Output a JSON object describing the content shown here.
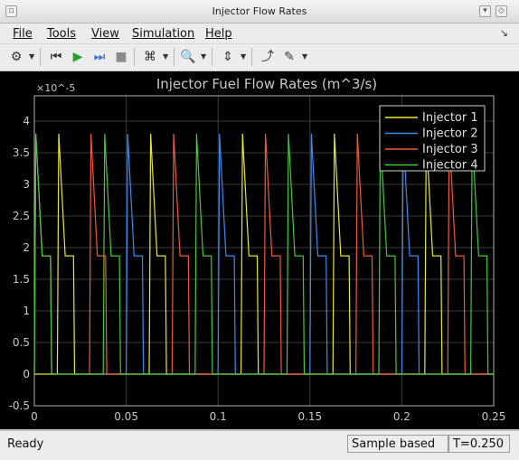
{
  "window": {
    "title": "Injector Flow Rates"
  },
  "menu": [
    "File",
    "Tools",
    "View",
    "Simulation",
    "Help"
  ],
  "toolbar": {
    "icons": [
      "gear-icon",
      "rewind-icon",
      "run-icon",
      "step-forward-icon",
      "stop-icon",
      "signal-select-icon",
      "zoom-icon",
      "fit-axes-icon",
      "highlight-block-icon",
      "style-icon"
    ]
  },
  "status": {
    "state": "Ready",
    "mode": "Sample based",
    "time": "T=0.250"
  },
  "colors": {
    "background": "#000000",
    "axes": "#b4b4b4",
    "grid": "#3a3a3a"
  },
  "chart_data": {
    "type": "line",
    "title": "Injector Fuel Flow Rates (m^3/s)",
    "y_exponent_label": "×10^-5",
    "xlim": [
      0,
      0.25
    ],
    "ylim": [
      -0.5,
      4.4
    ],
    "x_ticks": [
      0,
      0.05,
      0.1,
      0.15,
      0.2,
      0.25
    ],
    "x_tick_labels": [
      "0",
      "0.05",
      "0.1",
      "0.15",
      "0.2",
      "0.25"
    ],
    "y_ticks": [
      -0.5,
      0,
      0.5,
      1,
      1.5,
      2,
      2.5,
      3,
      3.5,
      4
    ],
    "y_tick_labels": [
      "-0.5",
      "0",
      "0.5",
      "1",
      "1.5",
      "2",
      "2.5",
      "3",
      "3.5",
      "4"
    ],
    "grid": true,
    "legend_position": "top-right",
    "pulse_shape": {
      "peak": 3.8,
      "plateau": 1.87,
      "rise_s": 0.0008,
      "decay_s": 0.0035,
      "plateau_s": 0.0045,
      "drop_s": 0.0006
    },
    "series": [
      {
        "name": "Injector 1",
        "color": "#e8e832",
        "pulse_starts": [
          0.0125,
          0.0625,
          0.1125,
          0.1625,
          0.2125
        ]
      },
      {
        "name": "Injector 2",
        "color": "#3c8cf0",
        "pulse_starts": [
          0.0,
          0.05,
          0.1,
          0.15,
          0.2
        ]
      },
      {
        "name": "Injector 3",
        "color": "#f05a3c",
        "pulse_starts": [
          0.0,
          0.03,
          0.075,
          0.125,
          0.175,
          0.225
        ]
      },
      {
        "name": "Injector 4",
        "color": "#46c83c",
        "pulse_starts": [
          0.0,
          0.0375,
          0.0875,
          0.1375,
          0.1875,
          0.2375
        ]
      }
    ]
  }
}
